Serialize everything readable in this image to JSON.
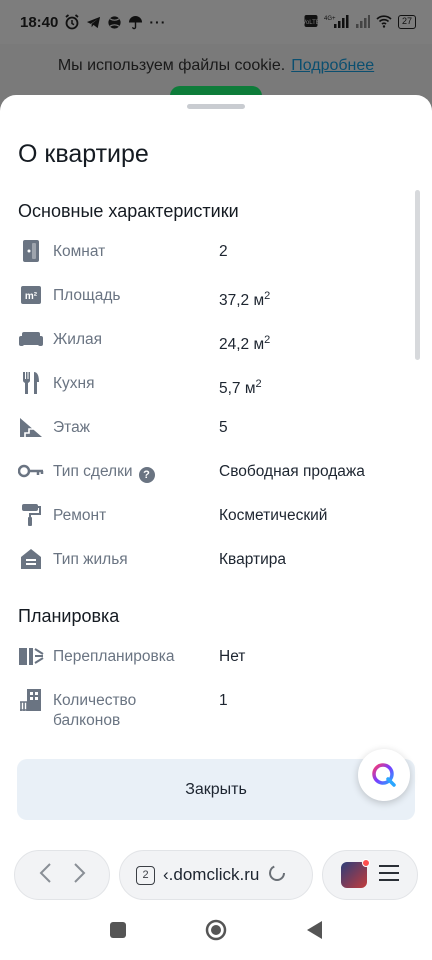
{
  "status_bar": {
    "time": "18:40",
    "battery": "27"
  },
  "cookie_banner": {
    "text": "Мы используем файлы cookie.",
    "link": "Подробнее"
  },
  "sheet": {
    "title": "О квартире",
    "sections": [
      {
        "title": "Основные характеристики",
        "rows": [
          {
            "icon": "door-icon",
            "label": "Комнат",
            "value": "2"
          },
          {
            "icon": "area-icon",
            "label": "Площадь",
            "value": "37,2 м",
            "sup": "2"
          },
          {
            "icon": "sofa-icon",
            "label": "Жилая",
            "value": "24,2 м",
            "sup": "2"
          },
          {
            "icon": "cutlery-icon",
            "label": "Кухня",
            "value": "5,7 м",
            "sup": "2"
          },
          {
            "icon": "stairs-icon",
            "label": "Этаж",
            "value": "5"
          },
          {
            "icon": "key-icon",
            "label": "Тип сделки",
            "value": "Свободная продажа"
          },
          {
            "icon": "paint-roller-icon",
            "label": "Ремонт",
            "value": "Косметический"
          },
          {
            "icon": "house-icon",
            "label": "Тип жилья",
            "value": "Квартира"
          }
        ]
      },
      {
        "title": "Планировка",
        "rows": [
          {
            "icon": "replanning-icon",
            "label": "Перепланировка",
            "value": "Нет"
          },
          {
            "icon": "balcony-icon",
            "label_line1": "Количество",
            "label_line2": "балконов",
            "value": "1"
          }
        ]
      }
    ],
    "close_button": "Закрыть"
  },
  "browser": {
    "tab_count": "2",
    "url": "‹.domclick.ru"
  },
  "colors": {
    "accent": "#0e7c3a",
    "label": "#6a7482",
    "close_bg": "#e9f0f7"
  }
}
